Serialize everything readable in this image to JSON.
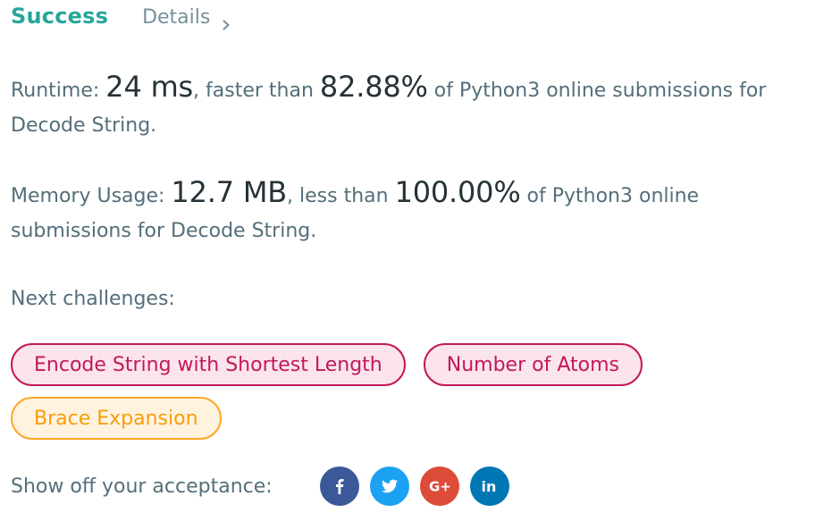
{
  "header": {
    "status": "Success",
    "details_label": "Details"
  },
  "runtime": {
    "label": "Runtime: ",
    "value": "24 ms",
    "middle": ", faster than ",
    "percent": "82.88%",
    "tail": " of Python3 online submissions for Decode String."
  },
  "memory": {
    "label": "Memory Usage: ",
    "value": "12.7 MB",
    "middle": ", less than ",
    "percent": "100.00%",
    "tail": " of Python3 online submissions for Decode String."
  },
  "next": {
    "label": "Next challenges:",
    "challenges": [
      {
        "label": "Encode String with Shortest Length",
        "difficulty": "hard"
      },
      {
        "label": "Number of Atoms",
        "difficulty": "hard"
      },
      {
        "label": "Brace Expansion",
        "difficulty": "medium"
      }
    ]
  },
  "share": {
    "label": "Show off your acceptance:",
    "networks": [
      {
        "name": "facebook-icon",
        "color": "#3b5998"
      },
      {
        "name": "twitter-icon",
        "color": "#1da1f2"
      },
      {
        "name": "google-plus-icon",
        "color": "#dd4b39"
      },
      {
        "name": "linkedin-icon",
        "color": "#0077b5"
      }
    ]
  },
  "colors": {
    "success": "#26a69a",
    "hard": "#c2185b",
    "medium": "#ffa726"
  }
}
